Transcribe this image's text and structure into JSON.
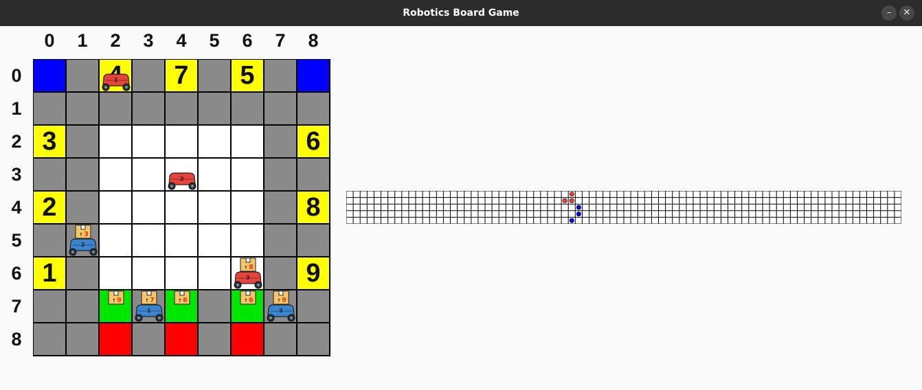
{
  "window": {
    "title": "Robotics Board Game",
    "minimize_icon": "minimize-icon",
    "close_icon": "close-icon"
  },
  "columns": [
    "0",
    "1",
    "2",
    "3",
    "4",
    "5",
    "6",
    "7",
    "8"
  ],
  "rows": [
    "0",
    "1",
    "2",
    "3",
    "4",
    "5",
    "6",
    "7",
    "8"
  ],
  "colors": {
    "gray": "#8e8e8e",
    "white": "#ffffff",
    "yellow": "#ffff00",
    "blue": "#0000ff",
    "green": "#00e600",
    "red": "#ff0000",
    "robot_red": "#e8433a",
    "robot_blue": "#3a85d0",
    "box_fill": "#f6c66b",
    "box_number": "#e04000"
  },
  "board": {
    "cells": [
      {
        "row": 0,
        "col": 0,
        "type": "blue"
      },
      {
        "row": 0,
        "col": 2,
        "type": "yellow",
        "label": "4"
      },
      {
        "row": 0,
        "col": 4,
        "type": "yellow",
        "label": "7"
      },
      {
        "row": 0,
        "col": 6,
        "type": "yellow",
        "label": "5"
      },
      {
        "row": 0,
        "col": 8,
        "type": "blue"
      },
      {
        "row": 2,
        "col": 0,
        "type": "yellow",
        "label": "3"
      },
      {
        "row": 2,
        "col": 8,
        "type": "yellow",
        "label": "6"
      },
      {
        "row": 4,
        "col": 0,
        "type": "yellow",
        "label": "2"
      },
      {
        "row": 4,
        "col": 8,
        "type": "yellow",
        "label": "8"
      },
      {
        "row": 6,
        "col": 0,
        "type": "yellow",
        "label": "1"
      },
      {
        "row": 6,
        "col": 8,
        "type": "yellow",
        "label": "9"
      },
      {
        "row": 7,
        "col": 2,
        "type": "green"
      },
      {
        "row": 7,
        "col": 4,
        "type": "green"
      },
      {
        "row": 7,
        "col": 6,
        "type": "green"
      },
      {
        "row": 8,
        "col": 2,
        "type": "red"
      },
      {
        "row": 8,
        "col": 4,
        "type": "red"
      },
      {
        "row": 8,
        "col": 6,
        "type": "red"
      }
    ],
    "white_region": {
      "rows": [
        2,
        6
      ],
      "cols": [
        2,
        6
      ]
    },
    "robots": [
      {
        "row": 0,
        "col": 2,
        "team": "red",
        "id": "1",
        "carrying": null
      },
      {
        "row": 3,
        "col": 4,
        "team": "red",
        "id": "2",
        "carrying": null
      },
      {
        "row": 6,
        "col": 6,
        "team": "red",
        "id": "3",
        "carrying": "8"
      },
      {
        "row": 5,
        "col": 1,
        "team": "blue",
        "id": "2",
        "carrying": "3"
      },
      {
        "row": 7,
        "col": 3,
        "team": "blue",
        "id": "1",
        "carrying": "7"
      },
      {
        "row": 7,
        "col": 7,
        "team": "blue",
        "id": "3",
        "carrying": "9"
      }
    ],
    "boxes": [
      {
        "row": 7,
        "col": 2,
        "label": "9"
      },
      {
        "row": 7,
        "col": 4,
        "label": "6"
      },
      {
        "row": 7,
        "col": 6,
        "label": "6"
      }
    ]
  },
  "side_grid": {
    "columns": 80,
    "rows": 5,
    "markers": [
      {
        "col": 32,
        "row": 0,
        "team": "red"
      },
      {
        "col": 32,
        "row": 1,
        "team": "red"
      },
      {
        "col": 31,
        "row": 1,
        "team": "red"
      },
      {
        "col": 33,
        "row": 2,
        "team": "blue"
      },
      {
        "col": 33,
        "row": 3,
        "team": "blue"
      },
      {
        "col": 32,
        "row": 4,
        "team": "blue"
      }
    ]
  }
}
